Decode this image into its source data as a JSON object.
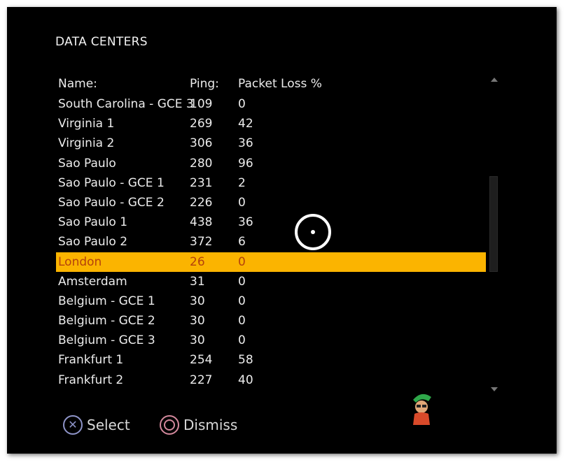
{
  "title": "DATA CENTERS",
  "columns": {
    "name": "Name:",
    "ping": "Ping:",
    "loss": "Packet Loss %"
  },
  "rows": [
    {
      "name": "South Carolina - GCE 3",
      "ping": "109",
      "loss": "0"
    },
    {
      "name": "Virginia 1",
      "ping": "269",
      "loss": "42"
    },
    {
      "name": "Virginia 2",
      "ping": "306",
      "loss": "36"
    },
    {
      "name": "Sao Paulo",
      "ping": "280",
      "loss": "96"
    },
    {
      "name": "Sao Paulo - GCE 1",
      "ping": "231",
      "loss": "2"
    },
    {
      "name": "Sao Paulo - GCE 2",
      "ping": "226",
      "loss": "0"
    },
    {
      "name": "Sao Paulo 1",
      "ping": "438",
      "loss": "36"
    },
    {
      "name": "Sao Paulo 2",
      "ping": "372",
      "loss": "6"
    },
    {
      "name": "London",
      "ping": "26",
      "loss": "0"
    },
    {
      "name": "Amsterdam",
      "ping": "31",
      "loss": "0"
    },
    {
      "name": "Belgium - GCE 1",
      "ping": "30",
      "loss": "0"
    },
    {
      "name": "Belgium - GCE 2",
      "ping": "30",
      "loss": "0"
    },
    {
      "name": "Belgium - GCE 3",
      "ping": "30",
      "loss": "0"
    },
    {
      "name": "Frankfurt 1",
      "ping": "254",
      "loss": "58"
    },
    {
      "name": "Frankfurt 2",
      "ping": "227",
      "loss": "40"
    }
  ],
  "selected_row": "London",
  "footer": {
    "select_label": "Select",
    "dismiss_label": "Dismiss",
    "select_icon": "cross-button-icon",
    "dismiss_icon": "circle-button-icon"
  },
  "colors": {
    "background": "#000000",
    "highlight": "#fbb400",
    "highlight_text": "#b4420c",
    "text": "#ececec"
  }
}
